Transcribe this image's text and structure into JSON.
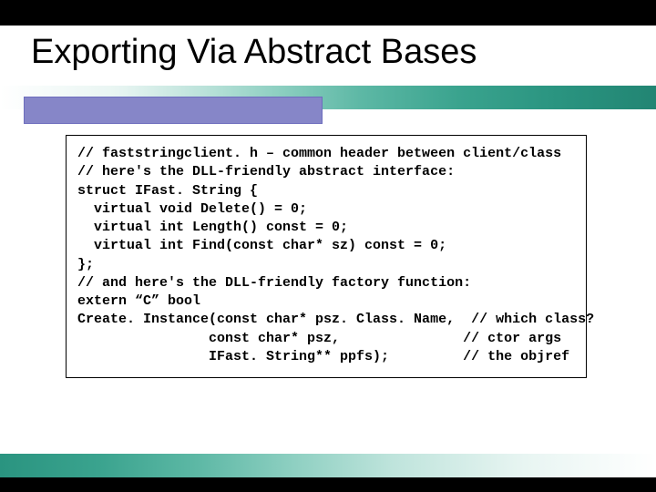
{
  "title": "Exporting Via Abstract Bases",
  "code": {
    "line1": "// faststringclient. h – common header between client/class",
    "blank1": "",
    "line2": "// here's the DLL-friendly abstract interface:",
    "line3": "struct IFast. String {",
    "line4": "  virtual void Delete() = 0;",
    "line5": "  virtual int Length() const = 0;",
    "line6": "  virtual int Find(const char* sz) const = 0;",
    "line7": "};",
    "blank2": "",
    "line8": "// and here's the DLL-friendly factory function:",
    "line9": "extern “C” bool",
    "line10": "Create. Instance(const char* psz. Class. Name,  // which class?",
    "line11": "                const char* psz,               // ctor args",
    "line12": "                IFast. String** ppfs);         // the objref"
  }
}
